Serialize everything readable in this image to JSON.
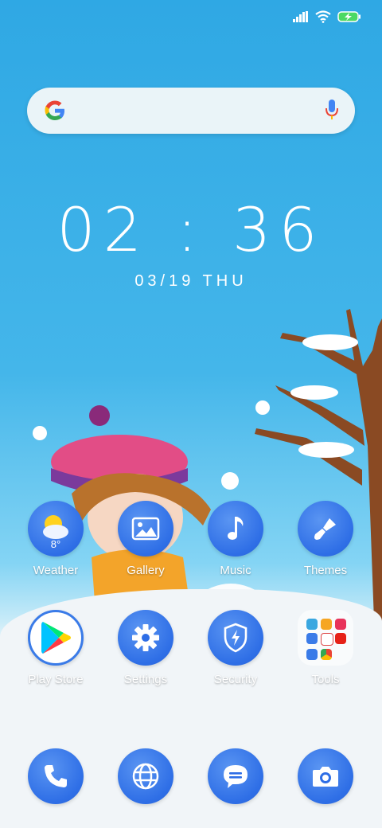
{
  "clock": {
    "time": "02 : 36",
    "date": "03/19  THU"
  },
  "weather": {
    "temperature": "8°"
  },
  "apps_row1": [
    {
      "label": "Weather"
    },
    {
      "label": "Gallery"
    },
    {
      "label": "Music"
    },
    {
      "label": "Themes"
    }
  ],
  "apps_row2": [
    {
      "label": "Play Store"
    },
    {
      "label": "Settings"
    },
    {
      "label": "Security"
    },
    {
      "label": "Tools"
    }
  ],
  "dock": [
    "phone-icon",
    "browser-icon",
    "messages-icon",
    "camera-icon"
  ],
  "colors": {
    "icon_blue": "#2e6ee6",
    "sky": "#2fa8e4"
  }
}
